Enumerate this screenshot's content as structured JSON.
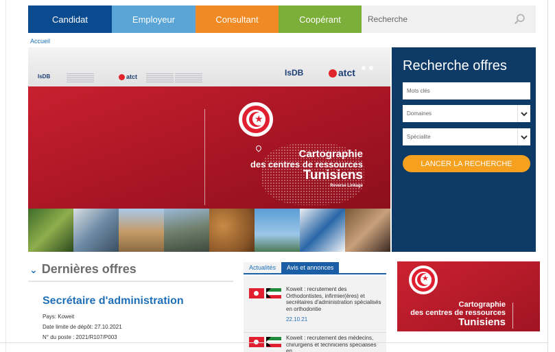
{
  "nav": {
    "tabs": [
      {
        "label": "Candidat",
        "color": "#0a4a8f"
      },
      {
        "label": "Employeur",
        "color": "#5aa5d6"
      },
      {
        "label": "Consultant",
        "color": "#f08a24"
      },
      {
        "label": "Coopérant",
        "color": "#7cae3a"
      }
    ],
    "search_placeholder": "Recherche",
    "search_icon": "search-icon"
  },
  "breadcrumb": "Accueil",
  "banner": {
    "logo_isdb": "IsDB",
    "logo_atct": "atct",
    "title_line1": "Cartographie",
    "title_line2": "des centres de ressources",
    "title_line3": "Tunisiens",
    "subtitle": "Reverse Linkage"
  },
  "offers_search": {
    "title": "Recherche offres",
    "keywords_placeholder": "Mots clés",
    "domains_label": "Domaines",
    "specialty_label": "Spécialite",
    "button": "LANCER LA RECHERCHE"
  },
  "latest_offers": {
    "heading": "Dernières offres",
    "job": {
      "title": "Secrétaire d'administration",
      "country": "Pays: Koweit",
      "deadline": "Date limite de dépôt: 27.10.2021",
      "post_number": "N° du poste : 2021/R107/P003"
    }
  },
  "news": {
    "tabs": [
      {
        "label": "Actualités",
        "active": false
      },
      {
        "label": "Avis et annonces",
        "active": true
      }
    ],
    "items": [
      {
        "text": "Koweit : recrutement des Orthodontistes, infirmier(ères) et secrétaires d'administration spécialisés en orthodontie",
        "date": "22.10.21"
      },
      {
        "text": "Koweit : recrutement des médecins, chirurgiens et techniciens spécialisés en",
        "date": ""
      }
    ]
  },
  "ad": {
    "line1": "Cartographie",
    "line2": "des centres de ressources",
    "line3": "Tunisiens"
  }
}
